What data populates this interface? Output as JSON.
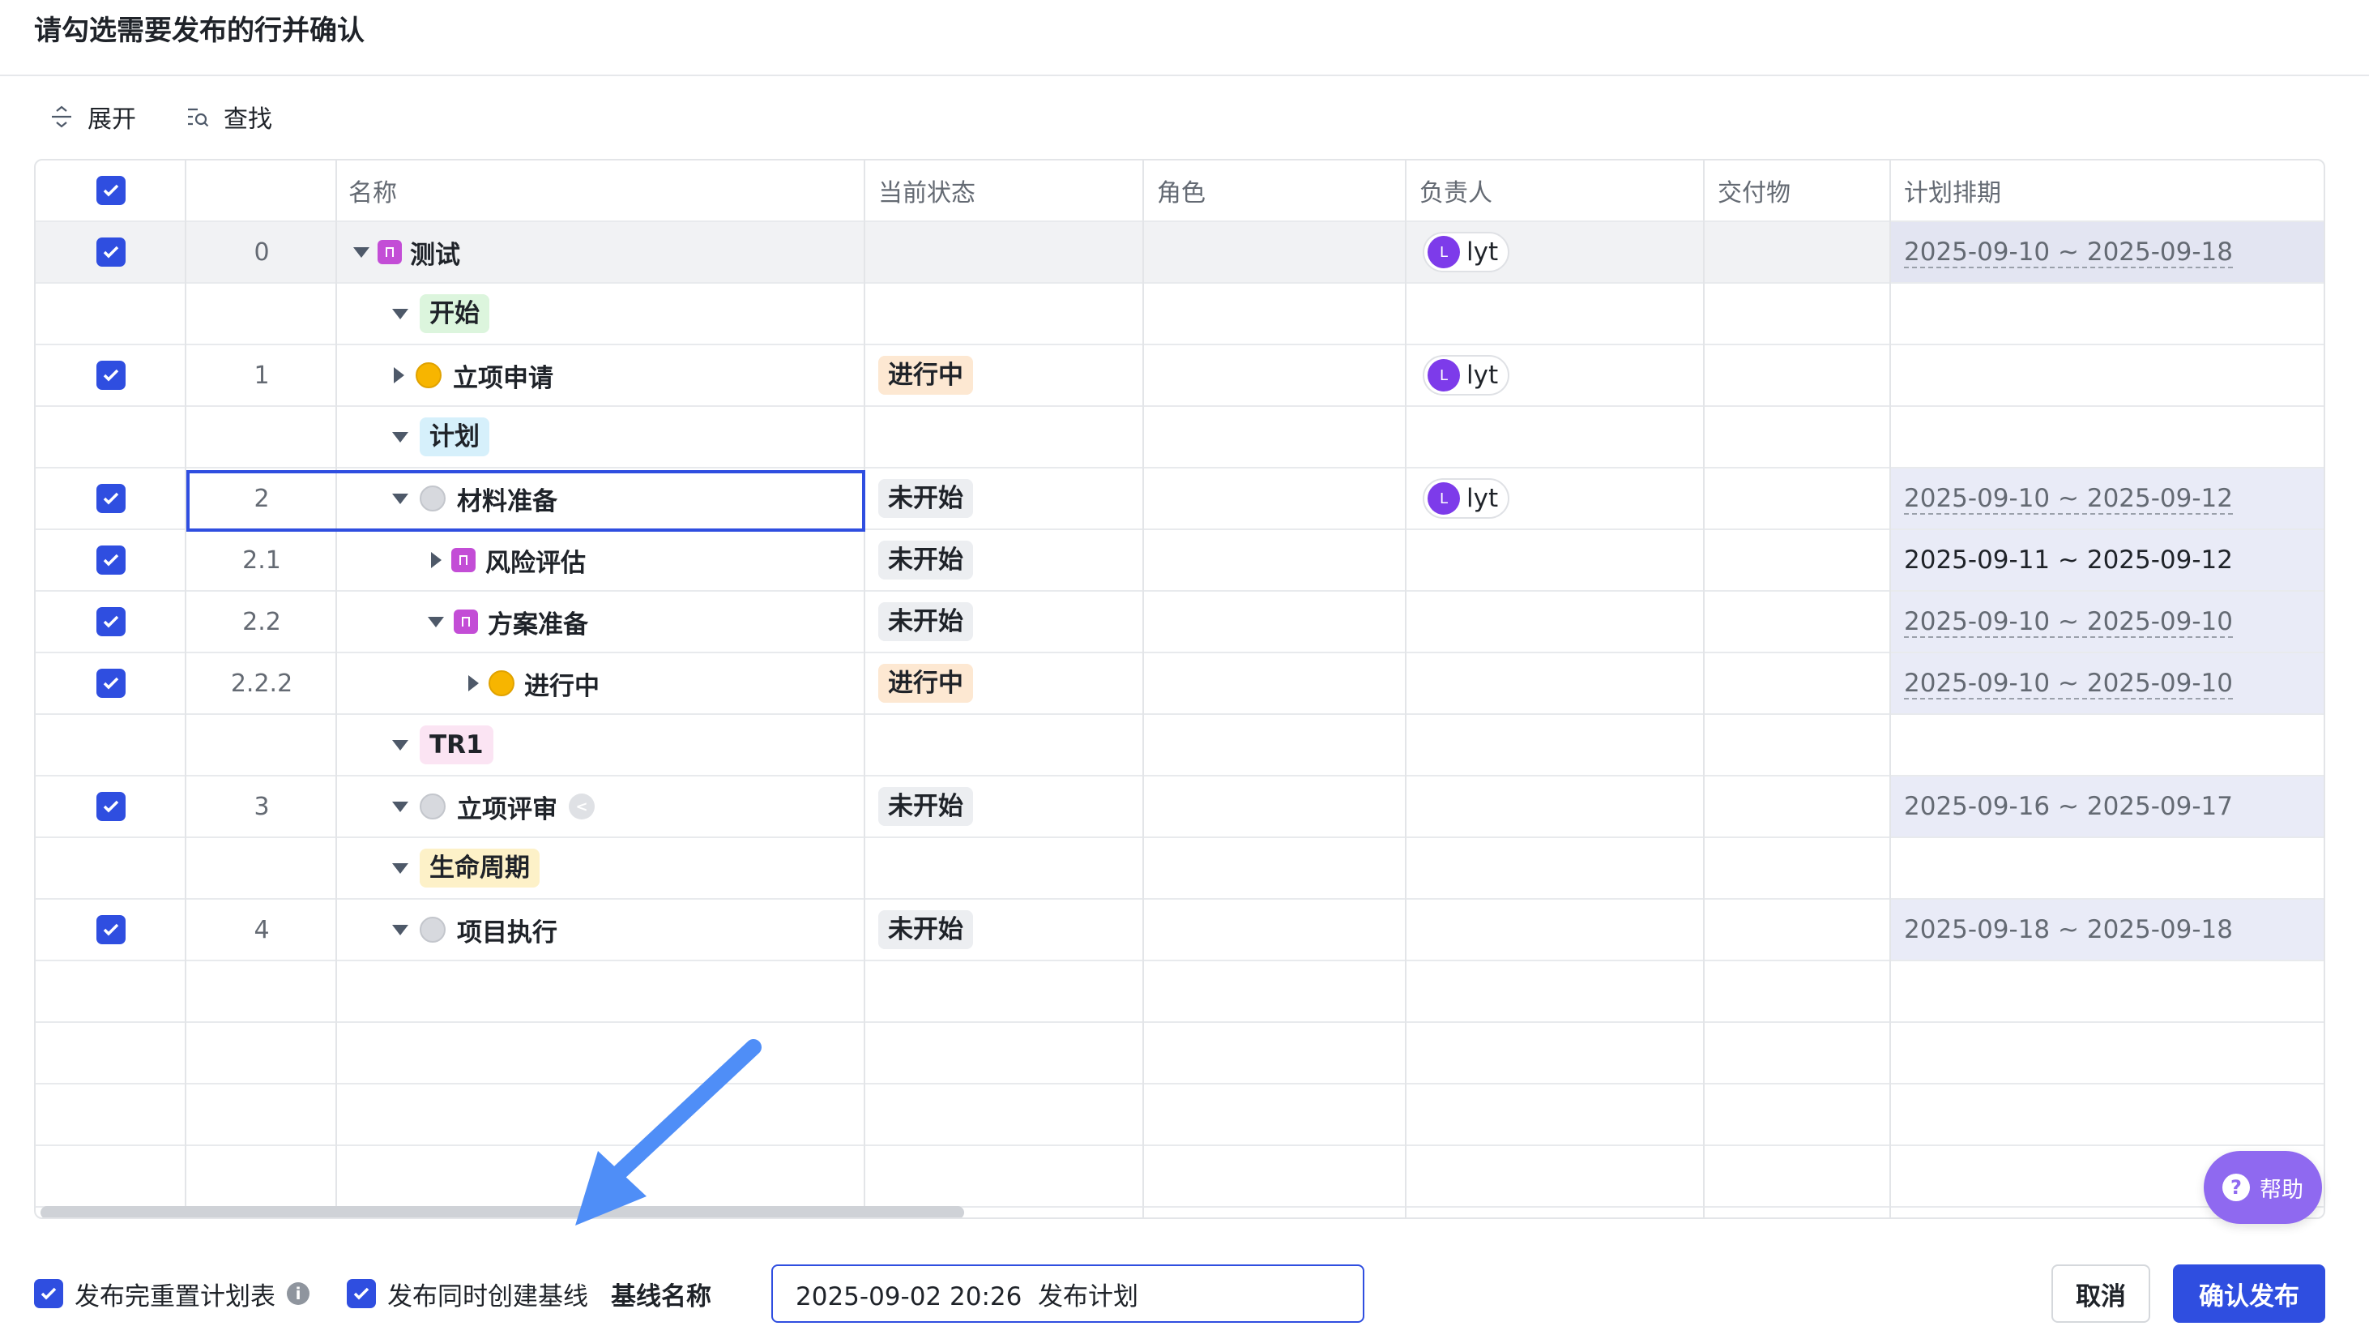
{
  "dialog": {
    "title": "请勾选需要发布的行并确认"
  },
  "toolbar": {
    "expand_label": "展开",
    "find_label": "查找"
  },
  "table": {
    "columns": [
      "名称",
      "当前状态",
      "角色",
      "负责人",
      "交付物",
      "计划排期"
    ],
    "rows": [
      {
        "id": "0",
        "name": "测试",
        "kind": "milestone",
        "owner": "lyt",
        "avatar": "L",
        "schedule": "2025-09-10 ~ 2025-09-18"
      },
      {
        "stage": "开始"
      },
      {
        "id": "1",
        "name": "立项申请",
        "kind": "task",
        "status": "进行中",
        "owner": "lyt",
        "avatar": "L"
      },
      {
        "stage": "计划"
      },
      {
        "id": "2",
        "name": "材料准备",
        "kind": "task",
        "status": "未开始",
        "owner": "lyt",
        "avatar": "L",
        "schedule": "2025-09-10 ~ 2025-09-12"
      },
      {
        "id": "2.1",
        "name": "风险评估",
        "kind": "milestone",
        "status": "未开始",
        "schedule": "2025-09-11 ~ 2025-09-12"
      },
      {
        "id": "2.2",
        "name": "方案准备",
        "kind": "milestone",
        "status": "未开始",
        "schedule": "2025-09-10 ~ 2025-09-10"
      },
      {
        "id": "2.2.2",
        "name": "进行中",
        "kind": "task",
        "status": "进行中",
        "schedule": "2025-09-10 ~ 2025-09-10"
      },
      {
        "stage": "TR1"
      },
      {
        "id": "3",
        "name": "立项评审",
        "kind": "task",
        "status": "未开始",
        "schedule": "2025-09-16 ~ 2025-09-17"
      },
      {
        "stage": "生命周期"
      },
      {
        "id": "4",
        "name": "项目执行",
        "kind": "task",
        "status": "未开始",
        "schedule": "2025-09-18 ~ 2025-09-18"
      }
    ]
  },
  "help": {
    "label": "帮助"
  },
  "footer": {
    "reset_label": "发布完重置计划表",
    "baseline_label": "发布同时创建基线",
    "baseline_name_label": "基线名称",
    "baseline_name_value": "2025-09-02 20:26  发布计划",
    "cancel_label": "取消",
    "confirm_label": "确认发布"
  },
  "colors": {
    "accent": "#2f4ee0",
    "milestone": "#c34dd6",
    "in_progress_dot": "#f7b500",
    "not_started_dot": "#d7d9de",
    "status_in_progress_bg": "#fde8d2",
    "status_not_started_bg": "#eceef1",
    "stage_start_bg": "#dcf5dd",
    "stage_plan_bg": "#d6f0fb",
    "stage_tr1_bg": "#fbe4f3",
    "stage_lifecycle_bg": "#fdf1c8",
    "help_button": "#8f69f0",
    "avatar": "#7d3bea"
  }
}
